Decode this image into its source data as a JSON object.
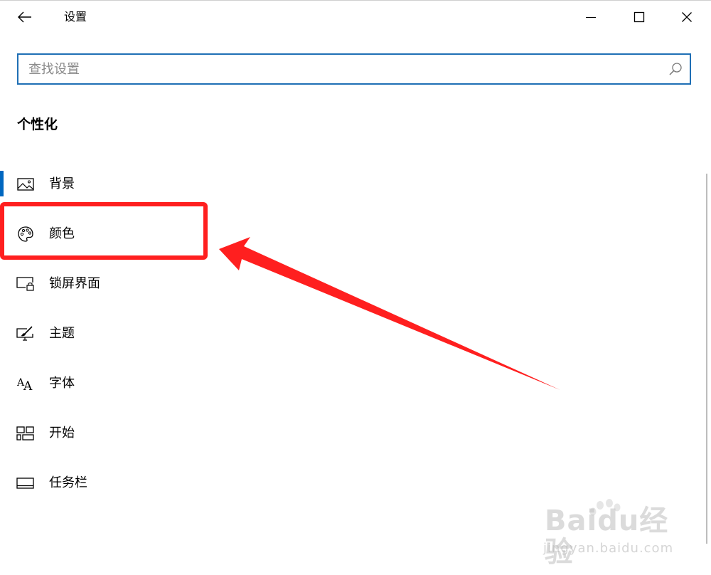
{
  "window": {
    "title": "设置"
  },
  "search": {
    "placeholder": "查找设置",
    "value": ""
  },
  "section": {
    "title": "个性化"
  },
  "nav": {
    "items": [
      {
        "label": "背景",
        "icon": "picture-icon",
        "selected": true
      },
      {
        "label": "颜色",
        "icon": "palette-icon",
        "selected": false
      },
      {
        "label": "锁屏界面",
        "icon": "lock-screen-icon",
        "selected": false
      },
      {
        "label": "主题",
        "icon": "theme-brush-icon",
        "selected": false
      },
      {
        "label": "字体",
        "icon": "font-icon",
        "selected": false
      },
      {
        "label": "开始",
        "icon": "start-tiles-icon",
        "selected": false
      },
      {
        "label": "任务栏",
        "icon": "taskbar-icon",
        "selected": false
      }
    ]
  },
  "annotation": {
    "color": "#ff1f1f"
  },
  "watermark": {
    "main": "Baidu经验",
    "sub": "jingyan.baidu.com"
  },
  "colors": {
    "accent": "#0067c0",
    "search_border": "#1f6fb5"
  }
}
